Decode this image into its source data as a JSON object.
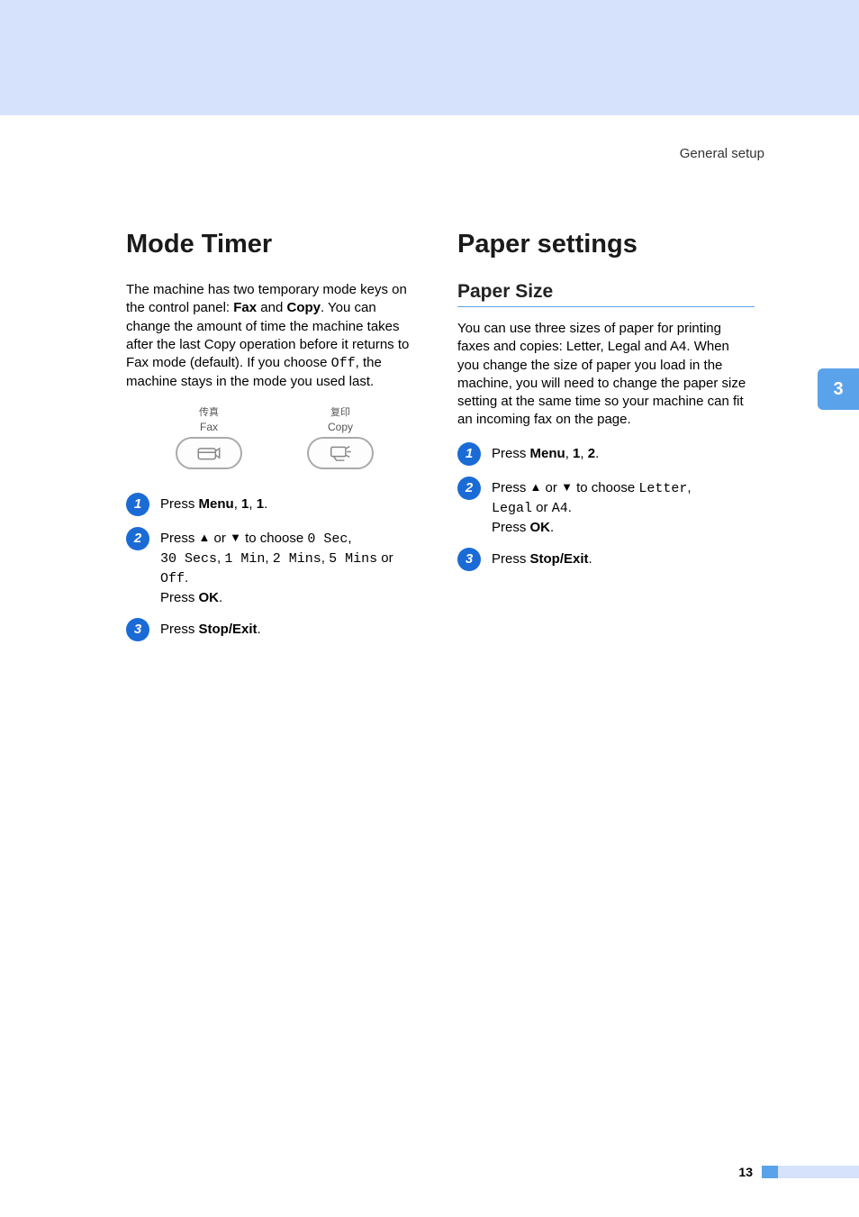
{
  "header": {
    "breadcrumb": "General setup"
  },
  "sideTab": {
    "chapter": "3"
  },
  "left": {
    "heading": "Mode Timer",
    "intro_parts": [
      "The machine has two temporary mode keys on the control panel: ",
      "Fax",
      " and ",
      "Copy",
      ". You can change the amount of time the machine takes after the last Copy operation before it returns to Fax mode (default). If you choose ",
      "Off",
      ", the machine stays in the mode you used last."
    ],
    "illustration": {
      "fax": {
        "cn": "传真",
        "en": "Fax"
      },
      "copy": {
        "cn": "复印",
        "en": "Copy"
      }
    },
    "steps": {
      "s1": {
        "num": "1",
        "prefix": "Press ",
        "bold1": "Menu",
        "comma1": ", ",
        "bold2": "1",
        "comma2": ", ",
        "bold3": "1",
        "suffix": "."
      },
      "s2": {
        "num": "2",
        "l1_prefix": "Press ",
        "l1_mid": " or ",
        "l1_suffix": " to choose ",
        "opt1": "0 Sec",
        "l1_end": ",",
        "l2_opt2": "30 Secs",
        "l2_c1": ", ",
        "l2_opt3": "1 Min",
        "l2_c2": ", ",
        "l2_opt4": "2 Mins",
        "l2_c3": ", ",
        "l2_opt5": "5 Mins",
        "l2_or": " or ",
        "l3_opt6": "Off",
        "l3_p": ".",
        "l4a": "Press ",
        "l4b": "OK",
        "l4c": "."
      },
      "s3": {
        "num": "3",
        "prefix": "Press ",
        "bold1": "Stop/Exit",
        "suffix": "."
      }
    }
  },
  "right": {
    "heading": "Paper settings",
    "subhead": "Paper Size",
    "intro": "You can use three sizes of paper for printing faxes and copies: Letter, Legal and A4. When you change the size of paper you load in the machine, you will need to change the paper size setting at the same time so your machine can fit an incoming fax on the page.",
    "steps": {
      "s1": {
        "num": "1",
        "prefix": "Press ",
        "bold1": "Menu",
        "comma1": ", ",
        "bold2": "1",
        "comma2": ", ",
        "bold3": "2",
        "suffix": "."
      },
      "s2": {
        "num": "2",
        "l1_prefix": "Press ",
        "l1_mid": " or ",
        "l1_suffix": " to choose ",
        "opt1": "Letter",
        "l1_end": ",",
        "l2_opt2": "Legal",
        "l2_or": " or ",
        "l2_opt3": "A4",
        "l2_p": ".",
        "l3a": "Press ",
        "l3b": "OK",
        "l3c": "."
      },
      "s3": {
        "num": "3",
        "prefix": "Press ",
        "bold1": "Stop/Exit",
        "suffix": "."
      }
    }
  },
  "footer": {
    "page": "13"
  }
}
